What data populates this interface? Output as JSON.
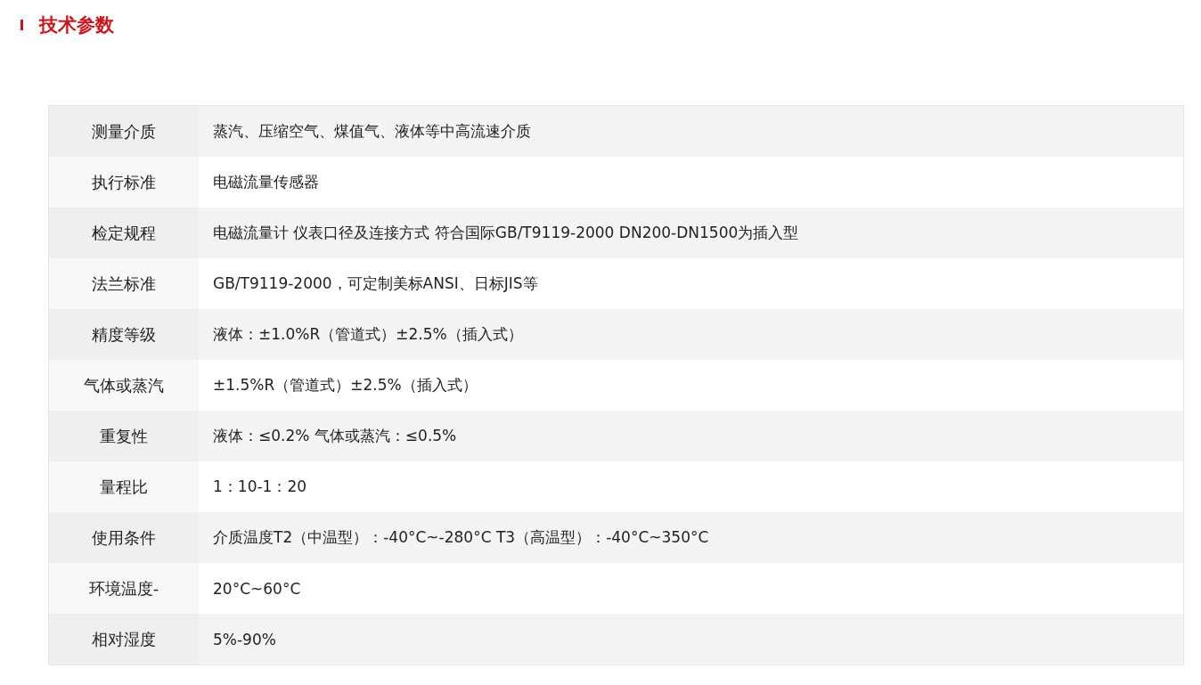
{
  "section_title": "技术参数",
  "specs": [
    {
      "label": "测量介质",
      "value": "蒸汽、压缩空气、煤值气、液体等中高流速介质"
    },
    {
      "label": "执行标准",
      "value": "电磁流量传感器"
    },
    {
      "label": "检定规程",
      "value": "电磁流量计  仪表口径及连接方式 符合国际GB/T9119-2000  DN200-DN1500为插入型"
    },
    {
      "label": "法兰标准",
      "value": "GB/T9119-2000，可定制美标ANSI、日标JIS等"
    },
    {
      "label": "精度等级",
      "value": "液体：±1.0%R（管道式）±2.5%（插入式）"
    },
    {
      "label": "气体或蒸汽",
      "value": "±1.5%R（管道式）±2.5%（插入式）"
    },
    {
      "label": "重复性",
      "value": "液体：≤0.2% 气体或蒸汽：≤0.5%"
    },
    {
      "label": "量程比",
      "value": "1：10-1：20"
    },
    {
      "label": "使用条件",
      "value": "介质温度T2（中温型）：-40°C~-280°C T3（高温型）：-40°C~350°C"
    },
    {
      "label": "环境温度-",
      "value": "20°C~60°C"
    },
    {
      "label": "相对湿度",
      "value": "5%-90%"
    }
  ]
}
